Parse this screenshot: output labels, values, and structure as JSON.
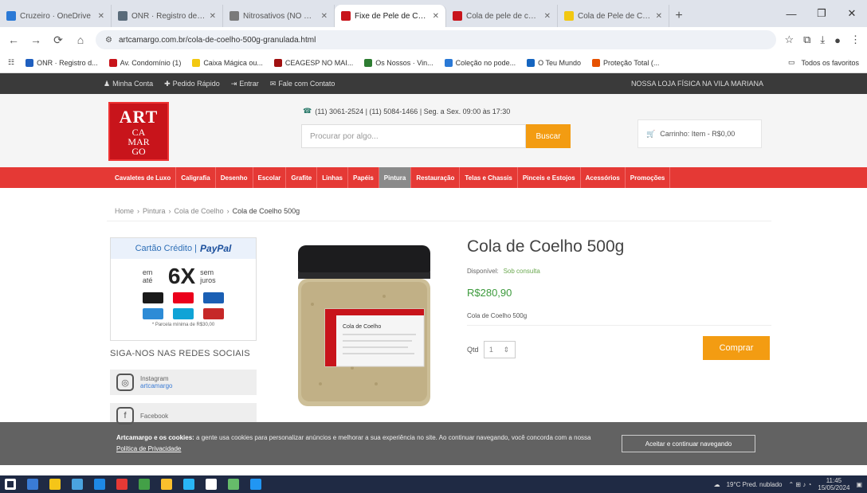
{
  "browser": {
    "tabs": [
      {
        "title": "Cruzeiro · OneDrive",
        "color": "#2a79d6"
      },
      {
        "title": "ONR · Registro de Imóve...",
        "color": "#5a6b7a"
      },
      {
        "title": "Nitrosativos (NO Cloreto...",
        "color": "#7a7a7a"
      },
      {
        "title": "Fixe de Pele de Coelho",
        "color": "#c8141b",
        "active": true
      },
      {
        "title": "Cola de pele de coelho...",
        "color": "#c8141b"
      },
      {
        "title": "Cola de Pele de Coelho...",
        "color": "#f2c811"
      }
    ],
    "new_tab": "+",
    "window_controls": [
      "—",
      "❐",
      "✕"
    ],
    "url": "artcamargo.com.br/cola-de-coelho-500g-granulada.html",
    "nav": [
      "←",
      "→",
      "⟳",
      "⌂"
    ],
    "bookmarks": [
      {
        "label": "ONR · Registro d...",
        "color": "#1f5fbf"
      },
      {
        "label": "Av. Condomínio (1)",
        "color": "#c8141b"
      },
      {
        "label": "Caixa Mágica ou...",
        "color": "#f2c811"
      },
      {
        "label": "CEAGESP NO MAI...",
        "color": "#a01010"
      },
      {
        "label": "Os Nossos · Vin...",
        "color": "#2e7d32"
      },
      {
        "label": "Coleção no pode...",
        "color": "#2a79d6"
      },
      {
        "label": "O Teu Mundo",
        "color": "#1565c0"
      },
      {
        "label": "Proteção Total (...",
        "color": "#e65100"
      }
    ],
    "bookmarks_right": "Todos os favoritos"
  },
  "site": {
    "topbar": {
      "links": [
        "Minha Conta",
        "Pedido Rápido",
        "Entrar",
        "Fale com Contato"
      ],
      "right": "NOSSA LOJA FÍSICA NA VILA MARIANA"
    },
    "logo": {
      "line1": "ART",
      "line2": "CA",
      "line3": "MAR",
      "line4": "GO"
    },
    "contact": "(11) 3061-2524 | (11) 5084-1466 | Seg. a Sex. 09:00 às 17:30",
    "search": {
      "placeholder": "Procurar por algo...",
      "button": "Buscar"
    },
    "cart": "Carrinho: Item - R$0,00",
    "menu": [
      "Cavaletes de Luxo",
      "Caligrafia",
      "Desenho",
      "Escolar",
      "Grafite",
      "Linhas",
      "Papéis",
      "Pintura",
      "Restauração",
      "Telas e Chassis",
      "Pinceis e Estojos",
      "Acessórios",
      "Promoções"
    ],
    "menu_active_index": 7,
    "breadcrumb": [
      "Home",
      "Pintura",
      "Cola de Coelho",
      "Cola de Coelho 500g"
    ],
    "payment": {
      "title_left": "Cartão Crédito |",
      "title_brand": "PayPal",
      "small_left": "em até",
      "big": "6X",
      "small_right": "sem juros",
      "note": "* Parcela mínima de R$30,00",
      "card_colors": [
        "#1a1a1a",
        "#eb001b",
        "#1a5fb4",
        "#2d8bd6",
        "#0fa3d6",
        "#c62828"
      ]
    },
    "social": {
      "title": "SIGA-NOS NAS REDES SOCIAIS",
      "items": [
        {
          "name": "Instagram",
          "handle": "artcamargo"
        },
        {
          "name": "Facebook",
          "handle": ""
        }
      ]
    },
    "product": {
      "title": "Cola de Coelho 500g",
      "availability_label": "Disponível:",
      "availability_value": "Sob consulta",
      "price": "R$280,90",
      "description": "Cola de Coelho 500g",
      "qty_label": "Qtd",
      "qty_value": "1",
      "buy_button": "Comprar",
      "jar_label": "Cola de Coelho"
    },
    "cookie": {
      "text_bold": "Artcamargo e os cookies:",
      "text": "a gente usa cookies para personalizar anúncios e melhorar a sua experiência no site. Ao continuar navegando, você concorda com a nossa",
      "link": "Política de Privacidade",
      "button": "Aceitar e continuar navegando"
    }
  },
  "taskbar": {
    "icon_colors": [
      "#ffffff",
      "#3a7bd5",
      "#f5c518",
      "#4aa3df",
      "#1e88e5",
      "#e53935",
      "#43a047",
      "#fbc02d",
      "#29b6f6",
      "#ffffff",
      "#66bb6a",
      "#2196f3"
    ],
    "weather": "19°C  Pred. nublado",
    "time": "11:45",
    "date": "15/05/2024"
  }
}
